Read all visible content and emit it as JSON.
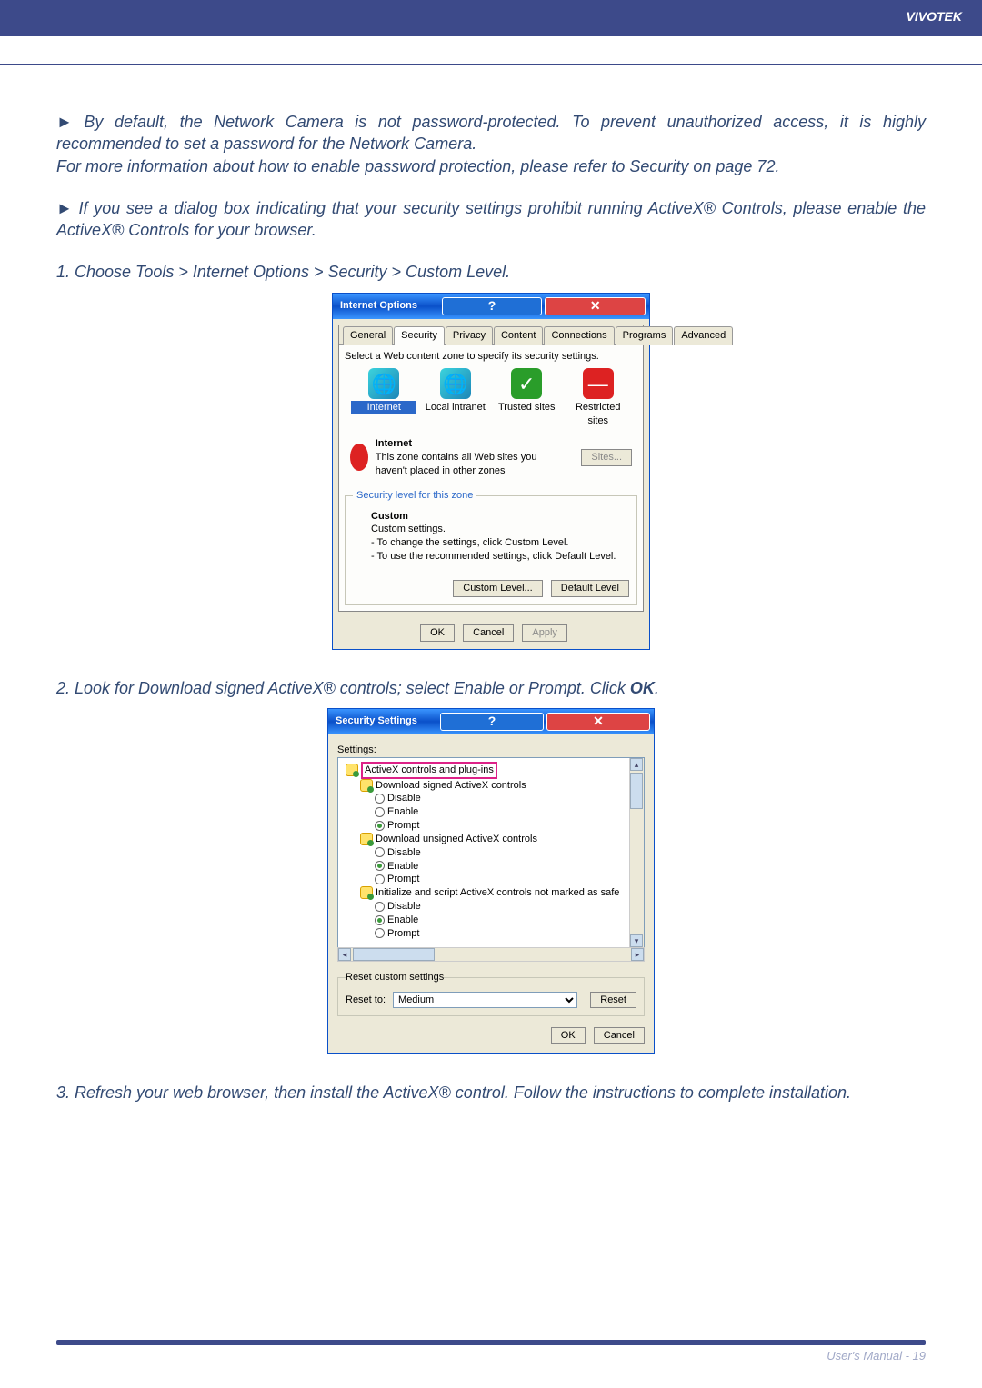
{
  "header": {
    "brand": "VIVOTEK"
  },
  "bullet1": {
    "line1": "By default, the Network Camera is not password-protected. To prevent unauthorized access, it is highly recommended to set a password for the Network Camera.",
    "line2": "For more information about how to enable password protection, please refer to Security on page 72."
  },
  "bullet2": "If you see a dialog box indicating that your security settings prohibit running ActiveX® Controls, please enable the ActiveX® Controls for your browser.",
  "step1": "1. Choose Tools > Internet Options > Security > Custom Level.",
  "step2_a": "2. Look for Download signed ActiveX® controls; select Enable or Prompt. Click ",
  "step2_b": "OK",
  "step2_c": ".",
  "step3": "3. Refresh your web browser, then install the ActiveX® control. Follow the instructions to complete installation.",
  "dlg1": {
    "title": "Internet Options",
    "tabs": [
      "General",
      "Security",
      "Privacy",
      "Content",
      "Connections",
      "Programs",
      "Advanced"
    ],
    "instr": "Select a Web content zone to specify its security settings.",
    "zones": [
      {
        "label": "Internet"
      },
      {
        "label": "Local intranet"
      },
      {
        "label": "Trusted sites",
        "glyph": "✓"
      },
      {
        "label": "Restricted sites",
        "glyph": "—"
      }
    ],
    "zoneHead": "Internet",
    "zoneDesc": "This zone contains all Web sites you haven't placed in other zones",
    "sites": "Sites...",
    "secLegend": "Security level for this zone",
    "custom": "Custom",
    "customSettings": "Custom settings.",
    "customL1": "- To change the settings, click Custom Level.",
    "customL2": "- To use the recommended settings, click Default Level.",
    "btnCustom": "Custom Level...",
    "btnDefault": "Default Level",
    "ok": "OK",
    "cancel": "Cancel",
    "apply": "Apply"
  },
  "dlg2": {
    "title": "Security Settings",
    "settings": "Settings:",
    "root": "ActiveX controls and plug-ins",
    "n1": "Download signed ActiveX controls",
    "n2": "Download unsigned ActiveX controls",
    "n3": "Initialize and script ActiveX controls not marked as safe",
    "opt": {
      "disable": "Disable",
      "enable": "Enable",
      "prompt": "Prompt"
    },
    "resetLegend": "Reset custom settings",
    "resetTo": "Reset to:",
    "resetVal": "Medium",
    "reset": "Reset",
    "ok": "OK",
    "cancel": "Cancel"
  },
  "footer": {
    "text": "User's Manual - 19"
  }
}
